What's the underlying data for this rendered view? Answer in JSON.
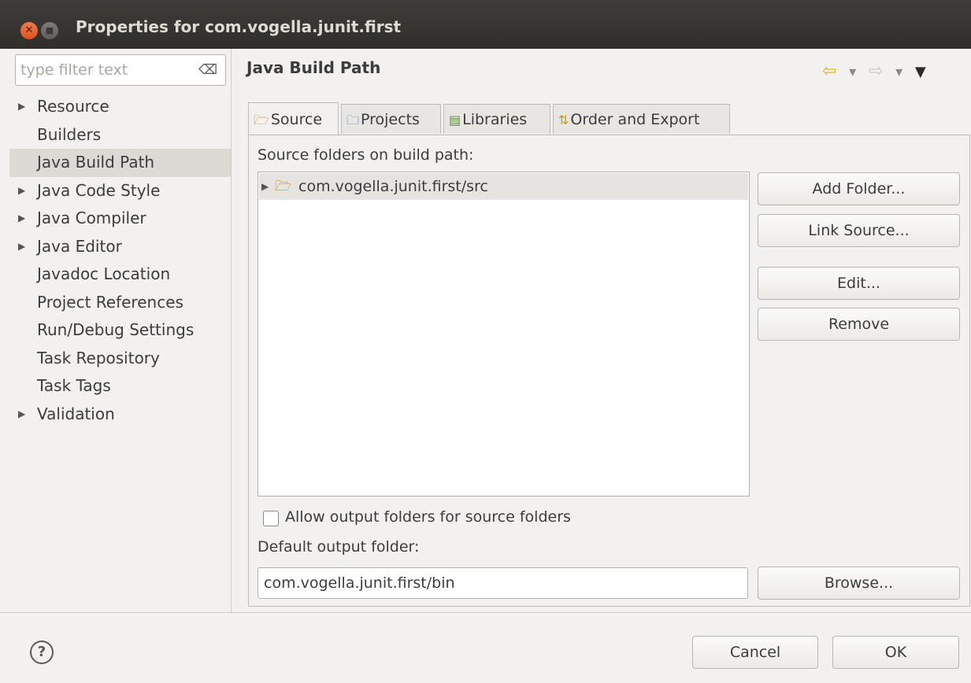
{
  "window": {
    "title": "Properties for com.vogella.junit.first",
    "close_glyph": "✕",
    "minimize_glyph": "■"
  },
  "sidebar": {
    "filter_placeholder": "type filter text",
    "clear_glyph": "⌫",
    "items": [
      {
        "label": "Resource",
        "expandable": true
      },
      {
        "label": "Builders",
        "expandable": false
      },
      {
        "label": "Java Build Path",
        "expandable": false,
        "selected": true
      },
      {
        "label": "Java Code Style",
        "expandable": true
      },
      {
        "label": "Java Compiler",
        "expandable": true
      },
      {
        "label": "Java Editor",
        "expandable": true
      },
      {
        "label": "Javadoc Location",
        "expandable": false
      },
      {
        "label": "Project References",
        "expandable": false
      },
      {
        "label": "Run/Debug Settings",
        "expandable": false
      },
      {
        "label": "Task Repository",
        "expandable": false
      },
      {
        "label": "Task Tags",
        "expandable": false
      },
      {
        "label": "Validation",
        "expandable": true
      }
    ]
  },
  "main": {
    "title": "Java Build Path",
    "nav": {
      "back_glyph": "⇦",
      "dropdown_glyph": "▾",
      "forward_glyph": "⇨",
      "menu_glyph": "▼"
    },
    "tabs": [
      {
        "label": "Source",
        "icon": "source-folder-icon",
        "glyph": "🗁",
        "active": true
      },
      {
        "label": "Projects",
        "icon": "project-folder-icon",
        "glyph": "🗀",
        "active": false
      },
      {
        "label": "Libraries",
        "icon": "libraries-icon",
        "glyph": "▤",
        "active": false
      },
      {
        "label": "Order and Export",
        "icon": "order-export-icon",
        "glyph": "⇅",
        "active": false
      }
    ],
    "source_label": "Source folders on build path:",
    "tree_items": [
      {
        "label": "com.vogella.junit.first/src",
        "expand_glyph": "▶",
        "folder_glyph": "🗁"
      }
    ],
    "buttons": {
      "add_folder": "Add Folder...",
      "link_source": "Link Source...",
      "edit": "Edit...",
      "remove": "Remove",
      "browse": "Browse..."
    },
    "allow_output_label": "Allow output folders for source folders",
    "allow_output_checked": false,
    "default_output_label": "Default output folder:",
    "default_output_value": "com.vogella.junit.first/bin"
  },
  "footer": {
    "help_glyph": "?",
    "cancel": "Cancel",
    "ok": "OK"
  }
}
